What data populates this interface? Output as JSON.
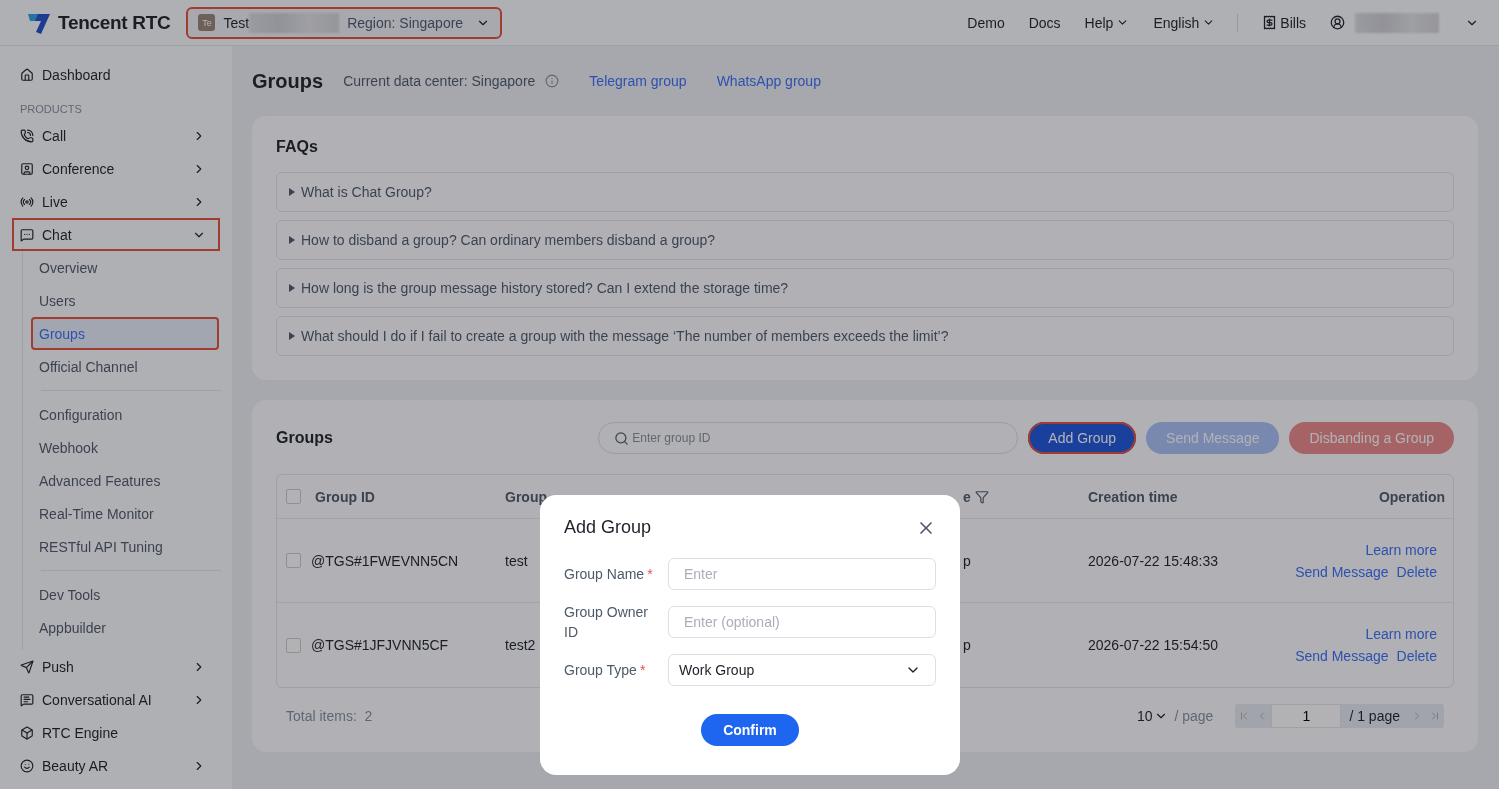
{
  "topbar": {
    "brand": "Tencent RTC",
    "app": {
      "avatar": "Te",
      "name": "Test",
      "region": "Region: Singapore",
      "annotated": true
    },
    "links": [
      {
        "label": "Demo",
        "dropdown": false
      },
      {
        "label": "Docs",
        "dropdown": false
      },
      {
        "label": "Help",
        "dropdown": true
      },
      {
        "label": "English",
        "dropdown": true
      }
    ],
    "bills": "Bills"
  },
  "sidebar": {
    "dashboard": "Dashboard",
    "section_label": "PRODUCTS",
    "items": [
      {
        "label": "Call",
        "kind": "group",
        "expanded": false,
        "annotated": false
      },
      {
        "label": "Conference",
        "kind": "group",
        "expanded": false,
        "annotated": false
      },
      {
        "label": "Live",
        "kind": "group",
        "expanded": false,
        "annotated": false
      },
      {
        "label": "Chat",
        "kind": "group",
        "expanded": true,
        "annotated": true,
        "sections": [
          [
            {
              "label": "Overview",
              "selected": false,
              "annotated": false
            },
            {
              "label": "Users",
              "selected": false,
              "annotated": false
            },
            {
              "label": "Groups",
              "selected": true,
              "annotated": true
            },
            {
              "label": "Official Channel",
              "selected": false,
              "annotated": false
            }
          ],
          [
            {
              "label": "Configuration",
              "selected": false,
              "annotated": false
            },
            {
              "label": "Webhook",
              "selected": false,
              "annotated": false
            },
            {
              "label": "Advanced Features",
              "selected": false,
              "annotated": false
            },
            {
              "label": "Real-Time Monitor",
              "selected": false,
              "annotated": false
            },
            {
              "label": "RESTful API Tuning",
              "selected": false,
              "annotated": false
            }
          ],
          [
            {
              "label": "Dev Tools",
              "selected": false,
              "annotated": false
            },
            {
              "label": "Appbuilder",
              "selected": false,
              "annotated": false
            }
          ]
        ]
      },
      {
        "label": "Push",
        "kind": "group",
        "expanded": false,
        "annotated": false
      },
      {
        "label": "Conversational AI",
        "kind": "group",
        "expanded": false,
        "annotated": false
      },
      {
        "label": "RTC Engine",
        "kind": "link",
        "annotated": false
      },
      {
        "label": "Beauty AR",
        "kind": "group",
        "expanded": false,
        "annotated": false
      }
    ]
  },
  "header": {
    "title": "Groups",
    "data_center": "Current data center: Singapore",
    "links": [
      "Telegram group",
      "WhatsApp group"
    ]
  },
  "faq": {
    "title": "FAQs",
    "items": [
      {
        "question": "What is Chat Group?",
        "expanded": false
      },
      {
        "question": "How to disband a group? Can ordinary members disband a group?",
        "expanded": false
      },
      {
        "question": "How long is the group message history stored? Can I extend the storage time?",
        "expanded": false
      },
      {
        "question": "What should I do if I fail to create a group with the message ‘The number of members exceeds the limit’?",
        "expanded": false
      }
    ]
  },
  "groups": {
    "title": "Groups",
    "search": {
      "placeholder": "Enter group ID"
    },
    "buttons": [
      {
        "label": "Add Group",
        "kind": "primary",
        "disabled": false,
        "annotated": true
      },
      {
        "label": "Send Message",
        "kind": "primary",
        "disabled": true,
        "annotated": false
      },
      {
        "label": "Disbanding a Group",
        "kind": "danger",
        "disabled": true,
        "annotated": false
      }
    ],
    "table": {
      "all_checked": false,
      "columns": [
        {
          "label": "Group ID",
          "filter": false
        },
        {
          "label": "Group",
          "filter": false
        },
        {
          "label": "e",
          "filter": true
        },
        {
          "label": "Creation time",
          "filter": false
        },
        {
          "label": "Operation",
          "filter": false
        }
      ],
      "rows": [
        {
          "checked": false,
          "cells": [
            "@TGS#1FWEVNN5CN",
            "test",
            "p",
            "2026-07-22 15:48:33"
          ],
          "actions": [
            "Learn more",
            "Send Message",
            "Delete"
          ]
        },
        {
          "checked": false,
          "cells": [
            "@TGS#1JFJVNN5CF",
            "test2",
            "p",
            "2026-07-22 15:54:50"
          ],
          "actions": [
            "Learn more",
            "Send Message",
            "Delete"
          ]
        }
      ]
    },
    "total": "Total items:  2",
    "page_size": "10",
    "per_page": "/ page",
    "page": "1",
    "page_count": "/ 1 page"
  },
  "modal": {
    "title": "Add Group",
    "fields": [
      {
        "label": "Group Name",
        "required": true,
        "required_mark": "*",
        "kind": "input",
        "placeholder": "Enter"
      },
      {
        "label": "Group Owner ID",
        "kind": "input",
        "placeholder": "Enter (optional)"
      },
      {
        "label": "Group Type",
        "required": true,
        "required_mark": "*",
        "kind": "select",
        "value": "Work Group"
      }
    ],
    "confirm": "Confirm"
  }
}
